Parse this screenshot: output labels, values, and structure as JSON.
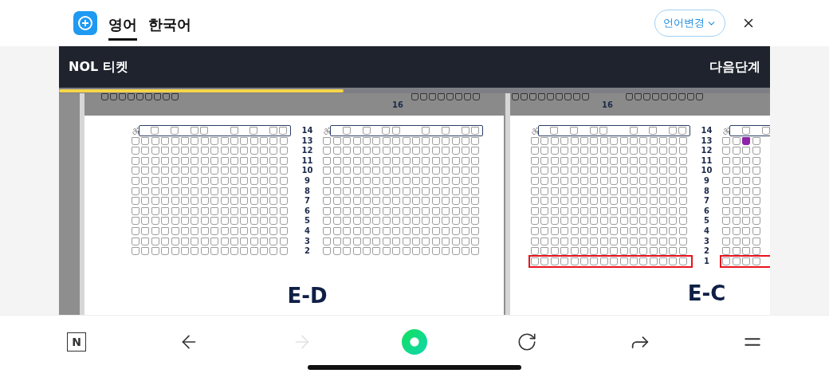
{
  "top_bar": {
    "tabs": [
      {
        "label": "영어",
        "selected": true
      },
      {
        "label": "한국어",
        "selected": false
      }
    ],
    "language_button": "언어변경"
  },
  "header": {
    "title": "NOL 티켓",
    "next_button": "다음단계",
    "progress": {
      "level": 0.4
    }
  },
  "seat_map": {
    "panels": [
      {
        "section": "E-D",
        "prev_row_label": "16",
        "rows": [
          {
            "label": "14",
            "kind": "wheelchair"
          },
          {
            "label": "13",
            "kind": "standard"
          },
          {
            "label": "12",
            "kind": "standard"
          },
          {
            "label": "11",
            "kind": "standard"
          },
          {
            "label": "10",
            "kind": "standard"
          },
          {
            "label": "9",
            "kind": "standard"
          },
          {
            "label": "8",
            "kind": "standard"
          },
          {
            "label": "7",
            "kind": "standard"
          },
          {
            "label": "6",
            "kind": "standard"
          },
          {
            "label": "5",
            "kind": "standard"
          },
          {
            "label": "4",
            "kind": "standard"
          },
          {
            "label": "3",
            "kind": "standard"
          },
          {
            "label": "2",
            "kind": "standard"
          }
        ]
      },
      {
        "section": "E-C",
        "prev_row_label": "16",
        "rows": [
          {
            "label": "14",
            "kind": "wheelchair"
          },
          {
            "label": "13",
            "kind": "standard",
            "right_seats": [
              false,
              false,
              true
            ]
          },
          {
            "label": "12",
            "kind": "standard"
          },
          {
            "label": "11",
            "kind": "standard"
          },
          {
            "label": "10",
            "kind": "standard"
          },
          {
            "label": "9",
            "kind": "standard"
          },
          {
            "label": "8",
            "kind": "standard"
          },
          {
            "label": "7",
            "kind": "standard"
          },
          {
            "label": "6",
            "kind": "standard"
          },
          {
            "label": "5",
            "kind": "standard"
          },
          {
            "label": "4",
            "kind": "standard"
          },
          {
            "label": "3",
            "kind": "standard"
          },
          {
            "label": "2",
            "kind": "standard"
          },
          {
            "label": "1",
            "kind": "standard",
            "outlined": true
          }
        ]
      }
    ]
  },
  "toolbar": [
    {
      "kind": "n-logo",
      "label": "N",
      "disabled": false
    },
    {
      "kind": "back",
      "disabled": false
    },
    {
      "kind": "forward",
      "disabled": true
    },
    {
      "kind": "home",
      "disabled": false
    },
    {
      "kind": "reload",
      "disabled": false
    },
    {
      "kind": "share",
      "disabled": false
    },
    {
      "kind": "menu",
      "disabled": false
    }
  ]
}
